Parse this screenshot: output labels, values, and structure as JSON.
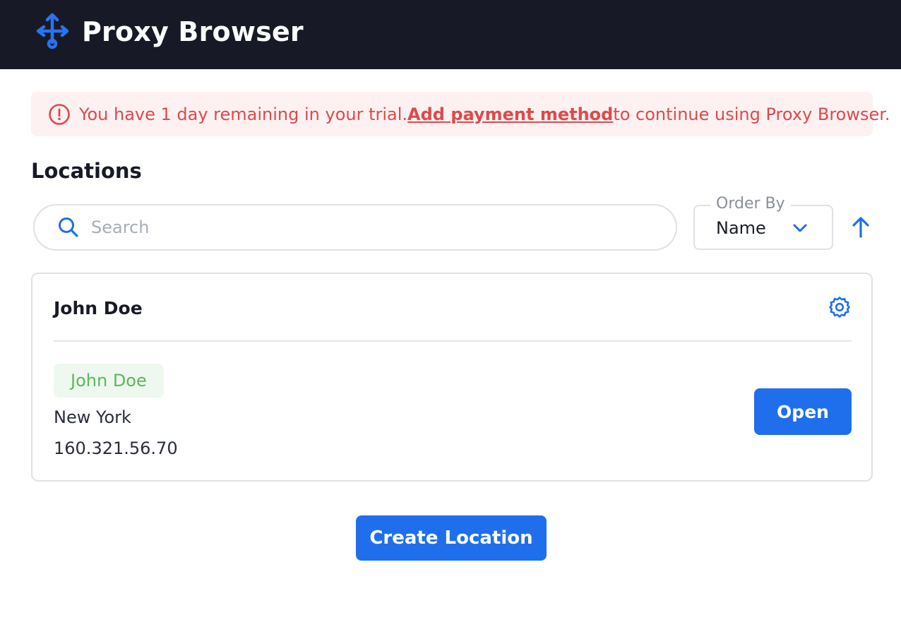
{
  "app": {
    "title": "Proxy Browser",
    "logo_icon": "network-fork-icon"
  },
  "banner": {
    "icon": "alert-circle-icon",
    "prefix": "You have 1 day remaining in your trial.",
    "link_label": "Add payment method",
    "suffix": "to continue using Proxy Browser.",
    "color": "#e0494a",
    "background": "#fdf1f1"
  },
  "locations": {
    "section_title": "Locations",
    "search": {
      "placeholder": "Search",
      "value": "",
      "icon": "search-icon"
    },
    "order_by": {
      "label": "Order By",
      "selected": "Name",
      "icon": "chevron-down-icon"
    },
    "sort_direction_icon": "arrow-up-icon",
    "items": [
      {
        "title": "John Doe",
        "settings_icon": "gear-icon",
        "tag": "John Doe",
        "city": "New York",
        "ip": "160.321.56.70",
        "open_label": "Open"
      }
    ],
    "create_label": "Create Location"
  },
  "colors": {
    "header": "#171a26",
    "accent": "#1f6fec",
    "tag_text": "#5cb85c",
    "tag_bg": "#eef8ee"
  }
}
